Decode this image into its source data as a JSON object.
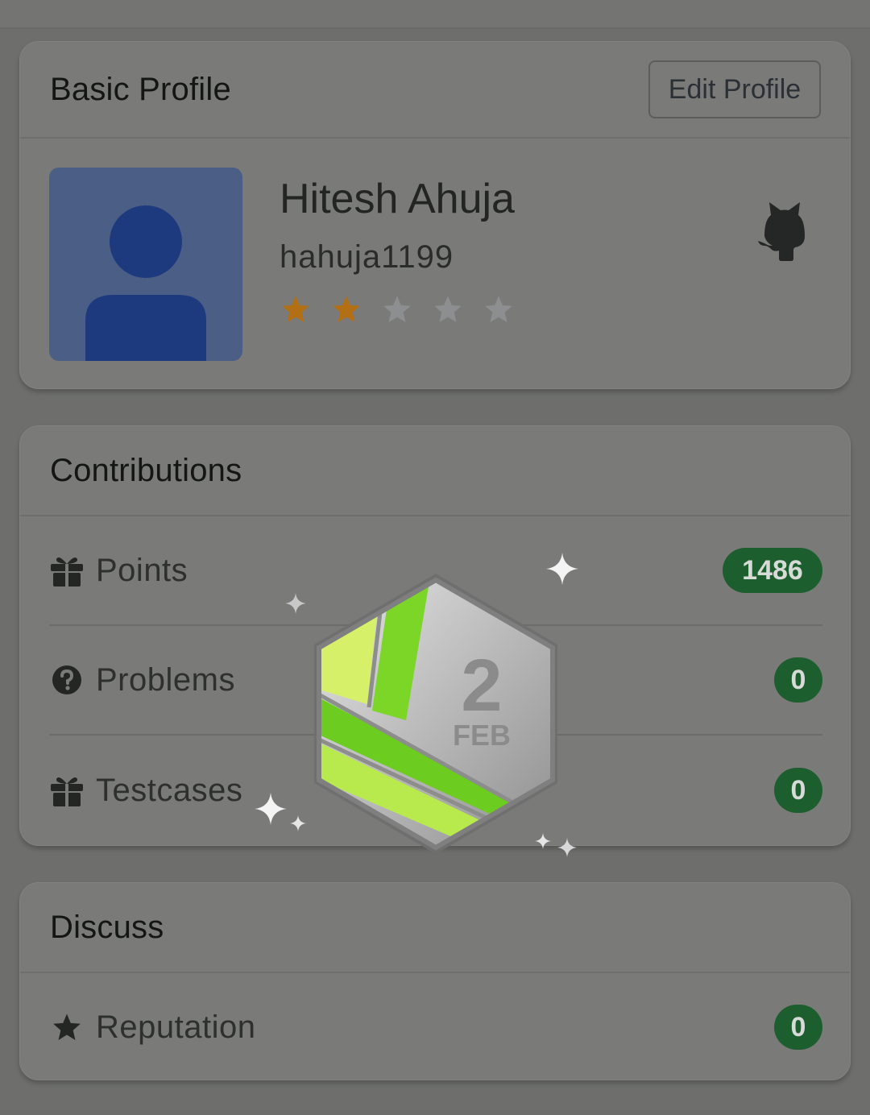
{
  "basic_profile": {
    "title": "Basic Profile",
    "edit_label": "Edit Profile",
    "name": "Hitesh Ahuja",
    "username": "hahuja1199",
    "rating": 2,
    "rating_max": 5,
    "avatar_icon": "person-icon",
    "github_icon": "github-icon"
  },
  "contributions": {
    "title": "Contributions",
    "rows": [
      {
        "label": "Points",
        "value": "1486",
        "icon": "gift-icon"
      },
      {
        "label": "Problems",
        "value": "0",
        "icon": "question-circle-icon"
      },
      {
        "label": "Testcases",
        "value": "0",
        "icon": "gift-icon"
      }
    ]
  },
  "discuss": {
    "title": "Discuss",
    "rows": [
      {
        "label": "Reputation",
        "value": "0",
        "icon": "star-icon"
      }
    ]
  },
  "badge_overlay": {
    "day": "2",
    "month": "FEB"
  },
  "colors": {
    "badge_green": "#1d5e2e",
    "star_filled": "#b36f14",
    "star_empty": "#8d8e90",
    "avatar_bg": "#4a5e86",
    "avatar_fg": "#1e3a7e"
  }
}
